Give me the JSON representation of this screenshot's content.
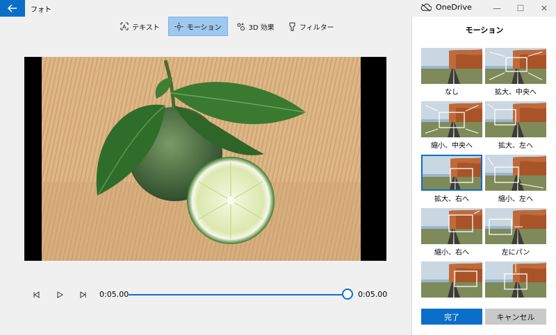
{
  "titlebar": {
    "app_title": "フォト",
    "onedrive_label": "OneDrive"
  },
  "toolbar": {
    "tools": [
      {
        "label": "テキスト",
        "icon": "text-icon"
      },
      {
        "label": "モーション",
        "icon": "motion-icon"
      },
      {
        "label": "3D 効果",
        "icon": "3d-effects-icon"
      },
      {
        "label": "フィルター",
        "icon": "filter-icon"
      }
    ],
    "active_index": 1
  },
  "player": {
    "current_time": "0:05.00",
    "end_time": "0:05.00",
    "progress": 1.0
  },
  "panel": {
    "title": "モーション",
    "items": [
      {
        "label": "なし"
      },
      {
        "label": "拡大、中央へ"
      },
      {
        "label": "縮小、中央へ"
      },
      {
        "label": "拡大、左へ"
      },
      {
        "label": "拡大、右へ"
      },
      {
        "label": "縮小、左へ"
      },
      {
        "label": "縮小、右へ"
      },
      {
        "label": "左にパン"
      },
      {
        "label": ""
      },
      {
        "label": ""
      }
    ],
    "selected_index": 4,
    "done_label": "完了",
    "cancel_label": "キャンセル"
  },
  "colors": {
    "accent": "#0b6fc9",
    "active_tool_bg": "#9ec8ee"
  }
}
